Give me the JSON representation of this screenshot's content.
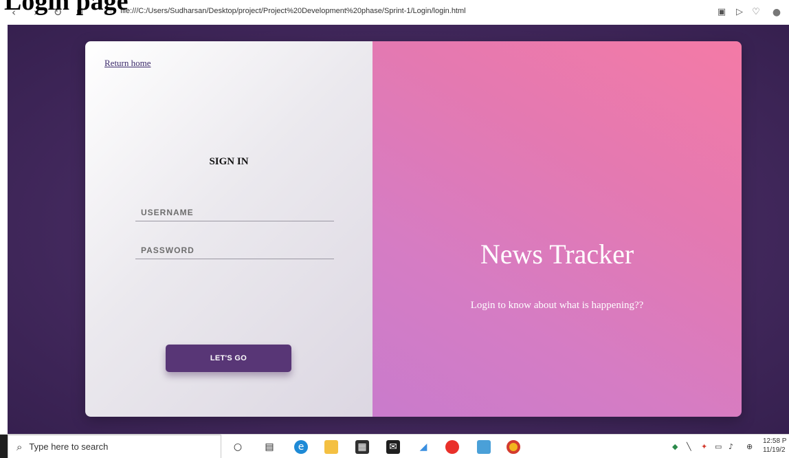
{
  "cropped_heading": "Login page",
  "browser": {
    "url": "file:///C:/Users/Sudharsan/Desktop/project/Project%20Development%20phase/Sprint-1/Login/login.html"
  },
  "left_panel": {
    "return_home": "Return home",
    "sign_in_title": "SIGN IN",
    "username_placeholder": "USERNAME",
    "password_placeholder": "PASSWORD",
    "submit_label": "LET'S GO"
  },
  "right_panel": {
    "brand": "News Tracker",
    "tagline": "Login to know about what is happening??"
  },
  "taskbar": {
    "search_placeholder": "Type here to search",
    "clock_time": "12:58 P",
    "clock_date": "11/19/2"
  },
  "colors": {
    "page_bg": "#3f2659",
    "button_bg": "#583676",
    "right_gradient_start": "#f47aa6",
    "right_gradient_end": "#c97bcc"
  },
  "icons": [
    "back-icon",
    "forward-icon",
    "reload-icon",
    "apps-icon",
    "page-icon",
    "screenshot-icon",
    "send-icon",
    "heart-icon",
    "profile-icon",
    "search-icon"
  ]
}
